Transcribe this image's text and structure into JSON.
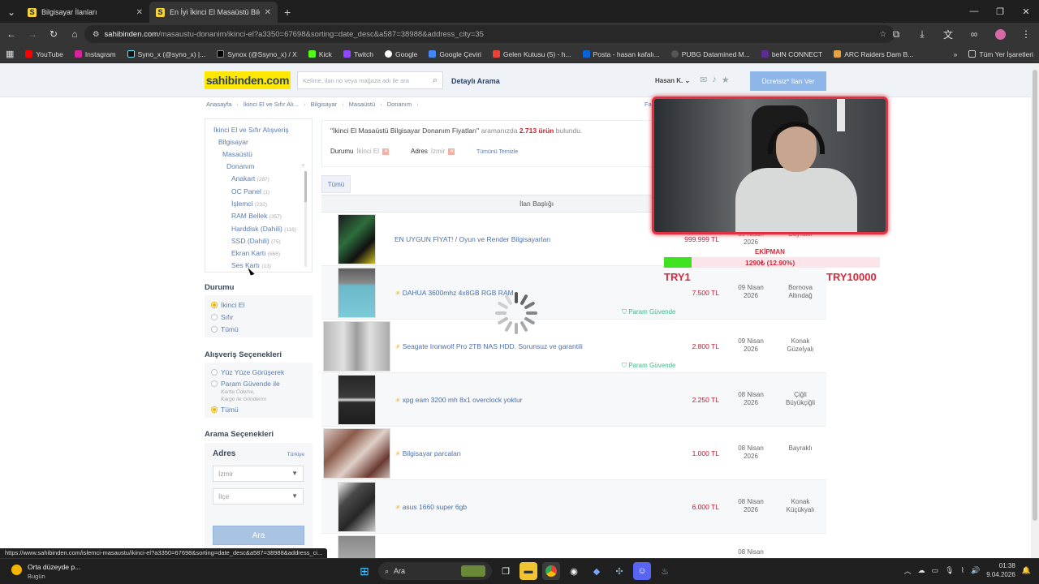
{
  "browser": {
    "tabs": [
      {
        "label": "Bilgisayar İlanları",
        "active": false
      },
      {
        "label": "En İyi İkinci El Masaüstü Bilgisa...",
        "active": true
      }
    ],
    "url_host": "sahibinden.com",
    "url_path": "/masaustu-donanim/ikinci-el?a3350=67698&sorting=date_desc&a587=38988&address_city=35",
    "bookmarks": [
      "YouTube",
      "Instagram",
      "Syno_x (@syno_x) |...",
      "Synox (@Ssyno_x) / X",
      "Kick",
      "Twitch",
      "Google",
      "Google Çeviri",
      "Gelen Kutusu (5) - h...",
      "Posta - hasan kafalı...",
      "PUBG Datamined M...",
      "beIN CONNECT",
      "ARC Raiders Dam B..."
    ],
    "all_bookmarks": "Tüm Yer İşaretleri",
    "status_url": "https://www.sahibinden.com/islemci-masaustu/ikinci-el?a3350=67698&sorting=date_desc&a587=38988&address_ci..."
  },
  "site": {
    "logo": "sahibinden.com",
    "search_placeholder": "Kelime, ilan no veya mağaza adı ile ara",
    "detailed_search": "Detaylı Arama",
    "user": "Hasan K.",
    "post_ad": "Ücretsiz* İlan Ver",
    "breadcrumbs": [
      "Anasayfa",
      "İkinci El ve Sıfır Alı...",
      "Bilgisayar",
      "Masaüstü",
      "Donanım"
    ],
    "breadcrumb_right": "Fa"
  },
  "categories": {
    "tree": [
      "İkinci El ve Sıfır Alışveriş",
      "Bilgisayar",
      "Masaüstü",
      "Donanım"
    ],
    "items": [
      {
        "label": "Anakart",
        "count": "(287)"
      },
      {
        "label": "OC Panel",
        "count": "(1)"
      },
      {
        "label": "İşlemci",
        "count": "(232)"
      },
      {
        "label": "RAM Bellek",
        "count": "(357)"
      },
      {
        "label": "Harddisk (Dahili)",
        "count": "(116)"
      },
      {
        "label": "SSD (Dahili)",
        "count": "(75)"
      },
      {
        "label": "Ekran Kartı",
        "count": "(666)"
      },
      {
        "label": "Ses Kartı",
        "count": "(13)"
      }
    ]
  },
  "filters": {
    "durum_title": "Durumu",
    "durum_options": [
      "İkinci El",
      "Sıfır",
      "Tümü"
    ],
    "durum_selected": 0,
    "alisveris_title": "Alışveriş Seçenekleri",
    "alisveris_options": [
      "Yüz Yüze Görüşerek",
      "Param Güvende ile",
      "Tümü"
    ],
    "alisveris_note1": "Kartla Ödeme,",
    "alisveris_note2": "Kargo ile Gönderim",
    "alisveris_selected": 2,
    "arama_title": "Arama Seçenekleri",
    "adres_title": "Adres",
    "country": "Türkiye",
    "city": "İzmir",
    "district_placeholder": "İlçe",
    "search_button": "Ara"
  },
  "results": {
    "title_prefix": "\"İkinci El Masaüstü Bilgisayar Donanım Fiyatları\"",
    "title_mid": "aramanızda",
    "count": "2.713 ürün",
    "title_suffix": "bulundu.",
    "chip1_label": "Durumu",
    "chip1_value": "İkinci El",
    "chip2_label": "Adres",
    "chip2_value": "İzmir",
    "clear_all": "Tümünü Temizle",
    "tab_all": "Tümü",
    "col_title": "İlan Başlığı",
    "listings": [
      {
        "title": "EN UYGUN FİYAT! / Oyun ve Render Bilgisayarları",
        "price": "999.999 TL",
        "date1": "09 Nisan",
        "date2": "2026",
        "loc1": "Bayraklı",
        "loc2": "",
        "featured": false,
        "safe": false
      },
      {
        "title": "DAHUA 3600mhz 4x8GB RGB RAM",
        "price": "7.500 TL",
        "date1": "09 Nisan",
        "date2": "2026",
        "loc1": "Bornova",
        "loc2": "Altındağ",
        "featured": true,
        "safe": true
      },
      {
        "title": "Seagate Ironwolf Pro 2TB NAS HDD. Sorunsuz ve garantili",
        "price": "2.800 TL",
        "date1": "09 Nisan",
        "date2": "2026",
        "loc1": "Konak",
        "loc2": "Güzelyalı",
        "featured": true,
        "safe": true
      },
      {
        "title": "xpg eam 3200 mh 8x1 overclock yoktur",
        "price": "2.250 TL",
        "date1": "08 Nisan",
        "date2": "2026",
        "loc1": "Çiğli",
        "loc2": "Büyükçiğli",
        "featured": true,
        "safe": false
      },
      {
        "title": "Bilgisayar parcaları",
        "price": "1.000 TL",
        "date1": "08 Nisan",
        "date2": "2026",
        "loc1": "Bayraklı",
        "loc2": "",
        "featured": true,
        "safe": false
      },
      {
        "title": "asus 1660 super 6gb",
        "price": "6.000 TL",
        "date1": "08 Nisan",
        "date2": "2026",
        "loc1": "Konak",
        "loc2": "Küçükyalı",
        "featured": true,
        "safe": false
      },
      {
        "title": "",
        "price": "",
        "date1": "08 Nisan",
        "date2": "",
        "loc1": "",
        "loc2": "",
        "featured": false,
        "safe": false
      }
    ],
    "safe_label": "Param Güvende"
  },
  "overlay": {
    "goal_label": "EKİPMAN",
    "goal_progress": "1290₺ (12.90%)",
    "goal_fraction": 0.129,
    "min_label": "TRY1",
    "max_label": "TRY10000"
  },
  "taskbar": {
    "weather_title": "Orta düzeyde p...",
    "weather_sub": "Bugün",
    "search": "Ara",
    "time": "01:38",
    "date": "9.04.2026"
  },
  "colors": {
    "brand_yellow": "#ffe800",
    "brand_blue": "#2d4369",
    "price_red": "#b01c36",
    "accent_red": "#d8283b"
  }
}
